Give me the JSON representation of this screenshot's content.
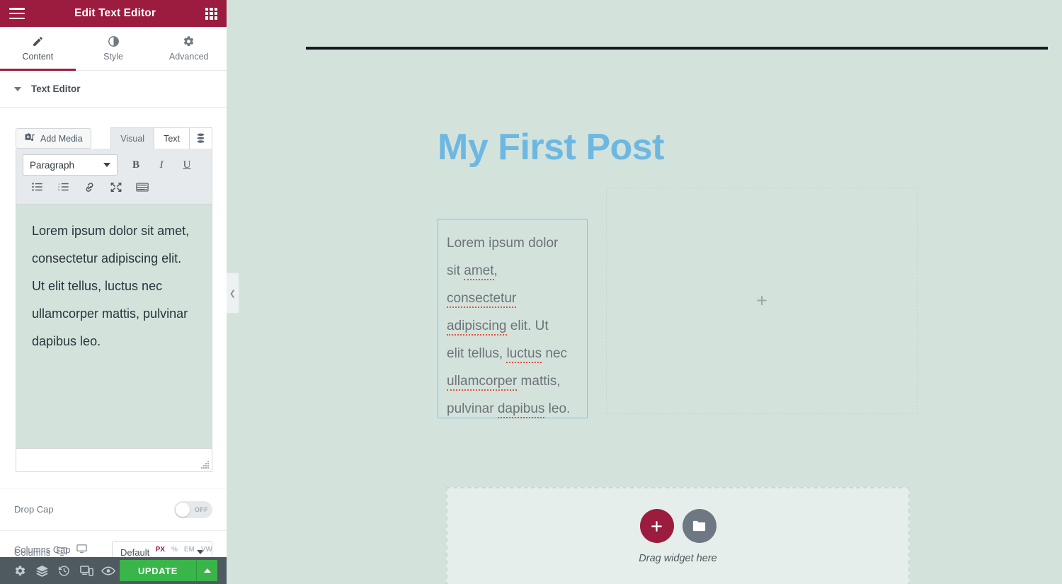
{
  "panel": {
    "header": {
      "title": "Edit Text Editor",
      "menu_icon": "hamburger-menu-icon",
      "apps_icon": "widgets-grid-icon"
    },
    "tabs": [
      {
        "label": "Content",
        "icon": "pencil-icon",
        "active": true
      },
      {
        "label": "Style",
        "icon": "contrast-circle-icon",
        "active": false
      },
      {
        "label": "Advanced",
        "icon": "gear-icon",
        "active": false
      }
    ],
    "section": {
      "label": "Text Editor",
      "caret": "chevron-down-icon"
    },
    "wp_editor": {
      "add_media_label": "Add Media",
      "add_media_icon": "media-camera-icon",
      "mode_tabs": [
        {
          "label": "Visual",
          "active": false
        },
        {
          "label": "Text",
          "active": true
        }
      ],
      "database_icon": "database-stack-icon",
      "format_select": {
        "value": "Paragraph",
        "caret": "chevron-down-icon"
      },
      "format_buttons": [
        {
          "name": "bold-button",
          "glyph": "B"
        },
        {
          "name": "italic-button",
          "glyph": "I"
        },
        {
          "name": "underline-button",
          "glyph": "U"
        }
      ],
      "tool_buttons": [
        {
          "name": "bullet-list-button",
          "icon": "bullet-list-icon"
        },
        {
          "name": "numbered-list-button",
          "icon": "numbered-list-icon"
        },
        {
          "name": "insert-link-button",
          "icon": "link-icon"
        },
        {
          "name": "fullscreen-button",
          "icon": "fullscreen-expand-icon"
        },
        {
          "name": "toolbar-toggle-button",
          "icon": "keyboard-toolbar-icon"
        }
      ],
      "content": "Lorem ipsum dolor sit amet, consectetur adipiscing elit. Ut elit tellus, luctus nec ullamcorper mattis, pulvinar dapibus leo.",
      "resize_handle": "resize-grip-icon"
    },
    "controls": {
      "drop_cap": {
        "label": "Drop Cap",
        "state": "OFF",
        "on": false
      },
      "columns": {
        "label": "Columns",
        "device_icon": "desktop-monitor-icon",
        "value": "Default"
      },
      "columns_gap": {
        "label": "Columns Gap",
        "device_icon": "desktop-monitor-icon",
        "units": [
          "PX",
          "%",
          "EM",
          "VW"
        ],
        "active_unit": "PX"
      }
    },
    "footer": {
      "icons": [
        {
          "name": "settings-gear-icon",
          "title": "Settings"
        },
        {
          "name": "navigator-layers-icon",
          "title": "Navigator"
        },
        {
          "name": "history-clock-icon",
          "title": "History"
        },
        {
          "name": "responsive-mode-icon",
          "title": "Responsive Mode"
        },
        {
          "name": "preview-eye-icon",
          "title": "Preview Changes"
        }
      ],
      "update_label": "UPDATE",
      "update_caret": "chevron-up-icon"
    },
    "collapse_tab": {
      "icon": "chevron-left-icon"
    }
  },
  "canvas": {
    "post_title": "My First Post",
    "text_widget": {
      "lines": [
        [
          {
            "t": "Lorem ipsum dolor",
            "sp": false
          }
        ],
        [
          {
            "t": "sit ",
            "sp": false
          },
          {
            "t": "amet",
            "sp": true
          },
          {
            "t": ",",
            "sp": false
          }
        ],
        [
          {
            "t": "consectetur",
            "sp": true
          }
        ],
        [
          {
            "t": "adipiscing",
            "sp": true
          },
          {
            "t": " elit. Ut",
            "sp": false
          }
        ],
        [
          {
            "t": "elit tellus, ",
            "sp": false
          },
          {
            "t": "luctus",
            "sp": true
          },
          {
            "t": " nec",
            "sp": false
          }
        ],
        [
          {
            "t": "ullamcorper",
            "sp": true
          },
          {
            "t": " mattis,",
            "sp": false
          }
        ],
        [
          {
            "t": "pulvinar ",
            "sp": false
          },
          {
            "t": "dapibus",
            "sp": true
          },
          {
            "t": " leo.",
            "sp": false
          }
        ]
      ]
    },
    "empty_column": {
      "add_icon": "plus-icon"
    },
    "dropzone": {
      "label": "Drag widget here",
      "add_button_icon": "plus-icon",
      "library_button_icon": "folder-template-icon"
    }
  },
  "colors": {
    "brand_crimson": "#9b1c3e",
    "panel_footer": "#4e5a5f",
    "update_green": "#39b54a",
    "canvas_bg": "#d4e2dc",
    "title_blue": "#6cb8e2",
    "spellcheck_red": "#e8503a",
    "widget_outline_blue": "#7cc5e8"
  }
}
